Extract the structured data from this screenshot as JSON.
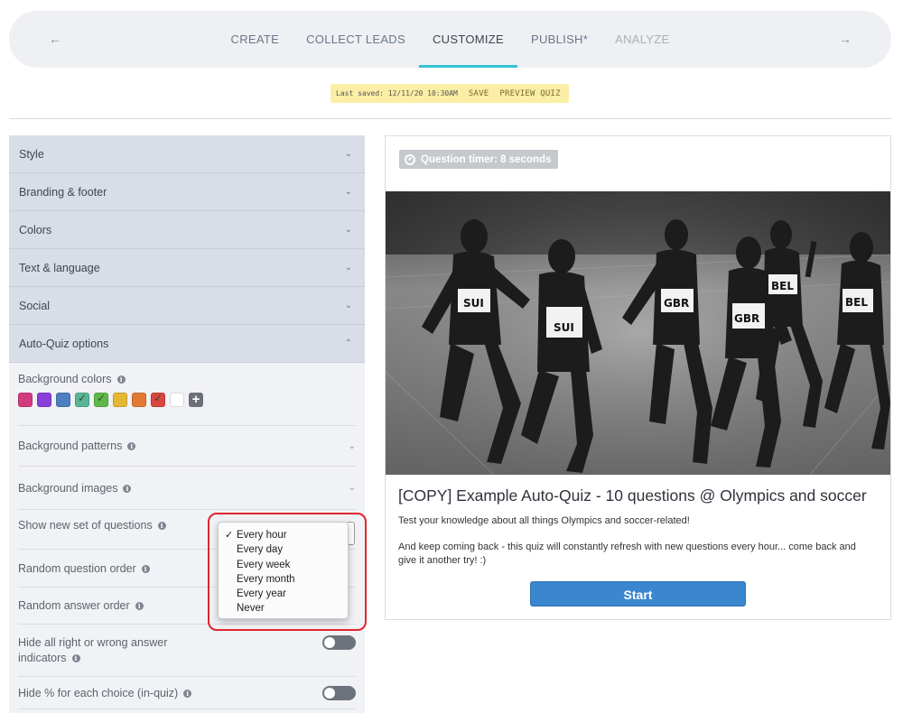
{
  "nav": {
    "steps": [
      {
        "label": "CREATE"
      },
      {
        "label": "COLLECT LEADS"
      },
      {
        "label": "CUSTOMIZE"
      },
      {
        "label": "PUBLISH*"
      },
      {
        "label": "ANALYZE"
      }
    ],
    "back_icon": "arrow-left-icon",
    "forward_icon": "arrow-right-icon"
  },
  "savebar": {
    "last_saved": "Last saved: 12/11/20 10:30AM",
    "save": "SAVE",
    "preview": "PREVIEW QUIZ"
  },
  "sidebar": {
    "sections": [
      {
        "label": "Style"
      },
      {
        "label": "Branding & footer"
      },
      {
        "label": "Colors"
      },
      {
        "label": "Text & language"
      },
      {
        "label": "Social"
      },
      {
        "label": "Auto-Quiz options"
      }
    ],
    "background_colors_label": "Background colors",
    "swatches": [
      "#d23a7e",
      "#8b3fd9",
      "#4d7ec0",
      "#5ab596",
      "#5eb84a",
      "#e6b733",
      "#e27933",
      "#d9463f",
      "#ffffff"
    ],
    "background_patterns_label": "Background patterns",
    "background_images_label": "Background images",
    "show_new_set_label": "Show new set of questions",
    "random_question_label": "Random question order",
    "random_answer_label": "Random answer order",
    "hide_indicators_label": "Hide all right or wrong answer indicators",
    "hide_percent_label": "Hide % for each choice (in-quiz)"
  },
  "dropdown": {
    "options": [
      "Every hour",
      "Every day",
      "Every week",
      "Every month",
      "Every year",
      "Never"
    ],
    "selected": "Every hour",
    "check": "✓"
  },
  "preview": {
    "timer": "Question timer: 8 seconds",
    "title": "[COPY] Example Auto-Quiz - 10 questions @ Olympics and soccer",
    "desc1": "Test your knowledge about all things Olympics and soccer-related!",
    "desc2": "And keep coming back - this quiz will constantly refresh with new questions every hour... come back and give it another try! :)",
    "start": "Start",
    "bibs": [
      "SUI",
      "SUI",
      "GBR",
      "GBR",
      "BEL",
      "BEL"
    ]
  },
  "colors": {
    "accent": "#34c3d3",
    "button": "#3a87cf",
    "highlight": "#e0262c",
    "savebar": "#fbeea6"
  }
}
